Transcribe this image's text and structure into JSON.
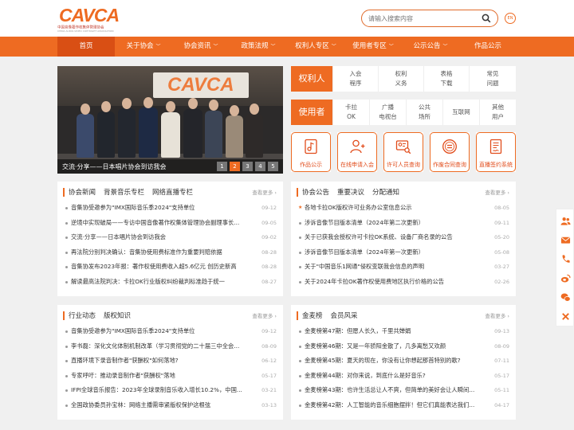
{
  "brand": {
    "name": "CAVCA",
    "subtitle": "中国音像著作权集体管理协会",
    "subtitle_en": "CHINA AUDIO-VIDEO COPYRIGHT ASSOCIATION"
  },
  "search": {
    "placeholder": "请输入搜索内容",
    "icon": "search-icon"
  },
  "lang": "EN",
  "nav": [
    {
      "label": "首页",
      "caret": false,
      "active": true
    },
    {
      "label": "关于协会",
      "caret": true
    },
    {
      "label": "协会资讯",
      "caret": true
    },
    {
      "label": "政策法规",
      "caret": true
    },
    {
      "label": "权利人专区",
      "caret": true
    },
    {
      "label": "使用者专区",
      "caret": true
    },
    {
      "label": "公示公告",
      "caret": true
    },
    {
      "label": "作品公示",
      "caret": false
    }
  ],
  "carousel": {
    "caption": "交流·分享——日本唱片协会到访我会",
    "pages": [
      "1",
      "2",
      "3",
      "4",
      "5"
    ],
    "active_page": 2
  },
  "rights_holder": {
    "title": "权利人",
    "items": [
      {
        "line1": "入会",
        "line2": "程序"
      },
      {
        "line1": "权利",
        "line2": "义务"
      },
      {
        "line1": "表格",
        "line2": "下载"
      },
      {
        "line1": "常见",
        "line2": "问题"
      }
    ]
  },
  "user": {
    "title": "使用者",
    "items": [
      {
        "line1": "卡拉",
        "line2": "OK"
      },
      {
        "line1": "广播",
        "line2": "电视台"
      },
      {
        "line1": "公共",
        "line2": "场所"
      },
      {
        "line1": "互联网",
        "line2": ""
      },
      {
        "line1": "其他",
        "line2": "用户"
      }
    ]
  },
  "services": [
    {
      "label": "作品公示",
      "icon": "music-document-icon"
    },
    {
      "label": "在线申请入会",
      "icon": "add-user-icon"
    },
    {
      "label": "许可人员查询",
      "icon": "id-card-search-icon"
    },
    {
      "label": "作废合同查询",
      "icon": "void-stamp-icon"
    },
    {
      "label": "直播签约系统",
      "icon": "contract-document-icon"
    }
  ],
  "more_label": "查看更多 ›",
  "panel_news": {
    "tabs": [
      "协会新闻",
      "背景音乐专栏",
      "网络直播专栏"
    ],
    "items": [
      {
        "title": "音集协受邀参为\"IMX国际音乐季2024\"支持单位",
        "date": "09-12"
      },
      {
        "title": "逆境中实现破局——专访中国音像著作权集体管理协会副理事长...",
        "date": "09-05"
      },
      {
        "title": "交流·分享——日本唱片协会到访我会",
        "date": "09-02"
      },
      {
        "title": "再法院分别判决确认：音集协使用费标准作为重要判赔依据",
        "date": "08-28"
      },
      {
        "title": "音集协发布2023年报：著作权使用费收入超5.6亿元 创历史新高",
        "date": "08-28"
      },
      {
        "title": "解读最高法院判决：卡拉OK行业版权纠纷裁判标准趋于统一",
        "date": "08-27"
      }
    ]
  },
  "panel_notice": {
    "tabs": [
      "协会公告",
      "重要决议",
      "分配通知"
    ],
    "items": [
      {
        "title": "各地卡拉OK版权许可业务办公室信息公示",
        "date": "08-05",
        "star": true
      },
      {
        "title": "涉诉音像节目版本清单（2024年第二次更新）",
        "date": "09-11"
      },
      {
        "title": "关于已获我会授权许可卡拉OK系统、设备厂商名录的公告",
        "date": "05-20"
      },
      {
        "title": "涉诉音像节目版本清单（2024年第一次更新）",
        "date": "05-08"
      },
      {
        "title": "关于\"中国音乐1网通\"侵权变联我会信息的声明",
        "date": "03-27"
      },
      {
        "title": "关于2024年卡拉OK著作权使用费地区执行价格的公告",
        "date": "02-26"
      }
    ]
  },
  "panel_industry": {
    "tabs": [
      "行业动态",
      "版权知识"
    ],
    "items": [
      {
        "title": "音集协受邀参为\"IMX国际音乐季2024\"支持单位",
        "date": "09-12"
      },
      {
        "title": "李书磊：深化文化体制机制改革（学习贯彻党的二十届三中全会...",
        "date": "08-09"
      },
      {
        "title": "直播环境下录音制作者\"获酬权\"如何落地?",
        "date": "06-12"
      },
      {
        "title": "专家呼吁：推动录音制作者\"获酬权\"落地",
        "date": "05-17"
      },
      {
        "title": "IFPI全球音乐报告：2023年全球录制音乐收入增长10.2%，中国...",
        "date": "03-21"
      },
      {
        "title": "全国政协委员孙宝林：网络主播需审紧版权保护这根弦",
        "date": "03-13"
      }
    ]
  },
  "panel_mic": {
    "tabs": [
      "金麦榜",
      "会员风采"
    ],
    "items": [
      {
        "title": "金麦榜第47期：但愿人长久，千里共婵娟",
        "date": "09-13"
      },
      {
        "title": "金麦榜第46期：又是一年骄阳金散了，几多离愁又欢颜",
        "date": "08-09"
      },
      {
        "title": "金麦榜第45期：夏天的现在，你没有让你想起那首特别的歌?",
        "date": "07-11"
      },
      {
        "title": "金麦榜第44期：对你来说，到底什么是好音乐?",
        "date": "05-17"
      },
      {
        "title": "金麦榜第43期：也许生活总让人不爽，但简单的美好会让人瞬间...",
        "date": "05-11"
      },
      {
        "title": "金麦榜第42期：人工智能的音乐细胞摆拌！但它们真能表达我们...",
        "date": "04-17"
      }
    ]
  },
  "float_bar": [
    "group-icon",
    "mail-icon",
    "phone-icon",
    "weibo-icon",
    "wechat-icon",
    "close-icon"
  ],
  "colors": {
    "accent": "#ee6b22",
    "nav_active": "#d94f14",
    "service_text": "#e14b1a"
  }
}
